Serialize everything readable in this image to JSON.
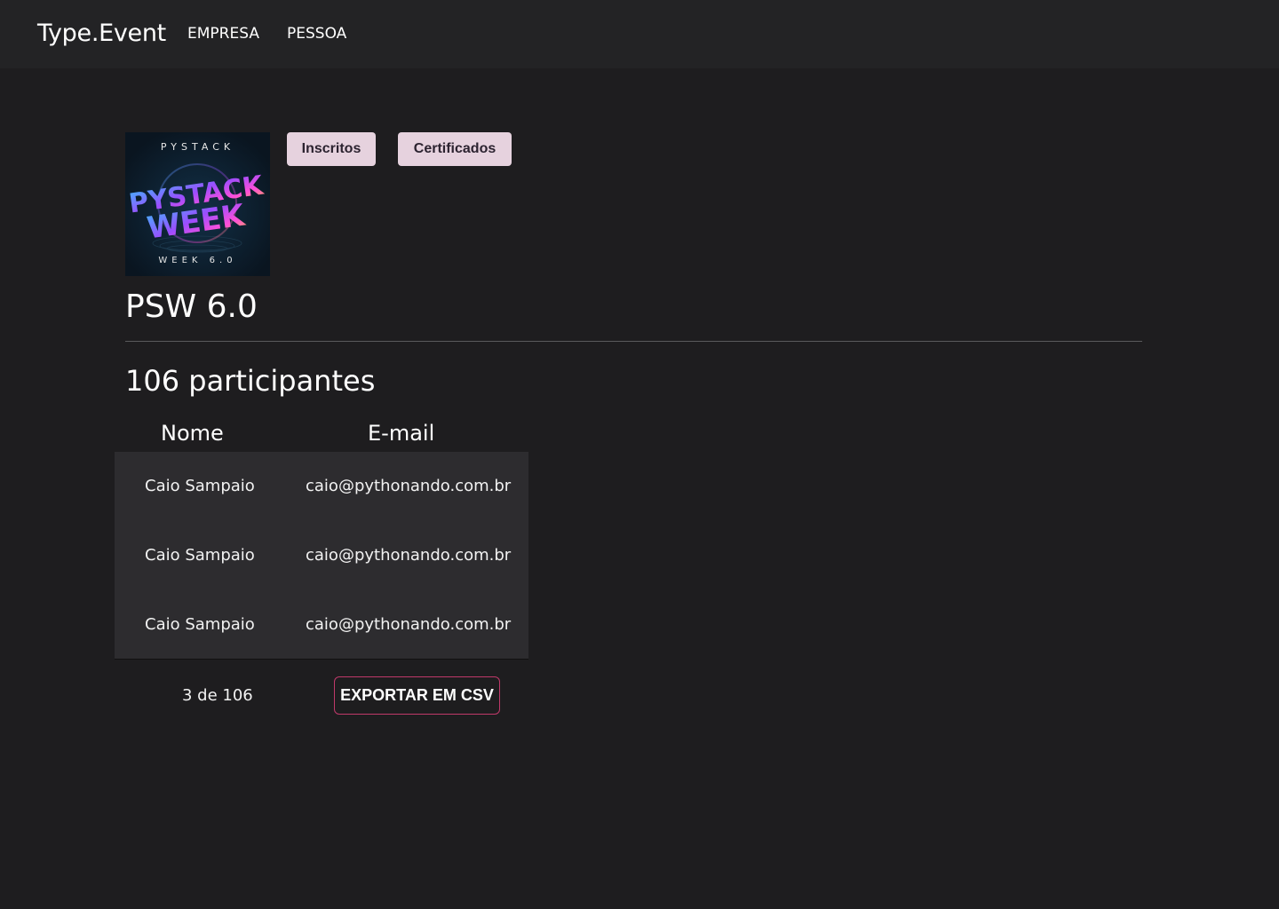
{
  "nav": {
    "brand": "Type.Event",
    "links": [
      "EMPRESA",
      "PESSOA"
    ]
  },
  "event": {
    "cover": {
      "top_text": "PYSTACK",
      "logo_text": "PYSTACK WEEK",
      "bottom_text": "WEEK 6.0"
    },
    "tabs": [
      "Inscritos",
      "Certificados"
    ],
    "title": "PSW 6.0"
  },
  "participants": {
    "count_label": "106 participantes",
    "columns": [
      "Nome",
      "E-mail"
    ],
    "rows": [
      {
        "name": "Caio Sampaio",
        "email": "caio@pythonando.com.br"
      },
      {
        "name": "Caio Sampaio",
        "email": "caio@pythonando.com.br"
      },
      {
        "name": "Caio Sampaio",
        "email": "caio@pythonando.com.br"
      }
    ],
    "pagination": "3 de 106",
    "export_label": "EXPORTAR EM CSV"
  },
  "colors": {
    "navbar": "#232325",
    "background": "#1e1d1f",
    "pill": "#e6d2de",
    "export_border": "#c0396a",
    "table_bg": "#2d2c2f"
  }
}
